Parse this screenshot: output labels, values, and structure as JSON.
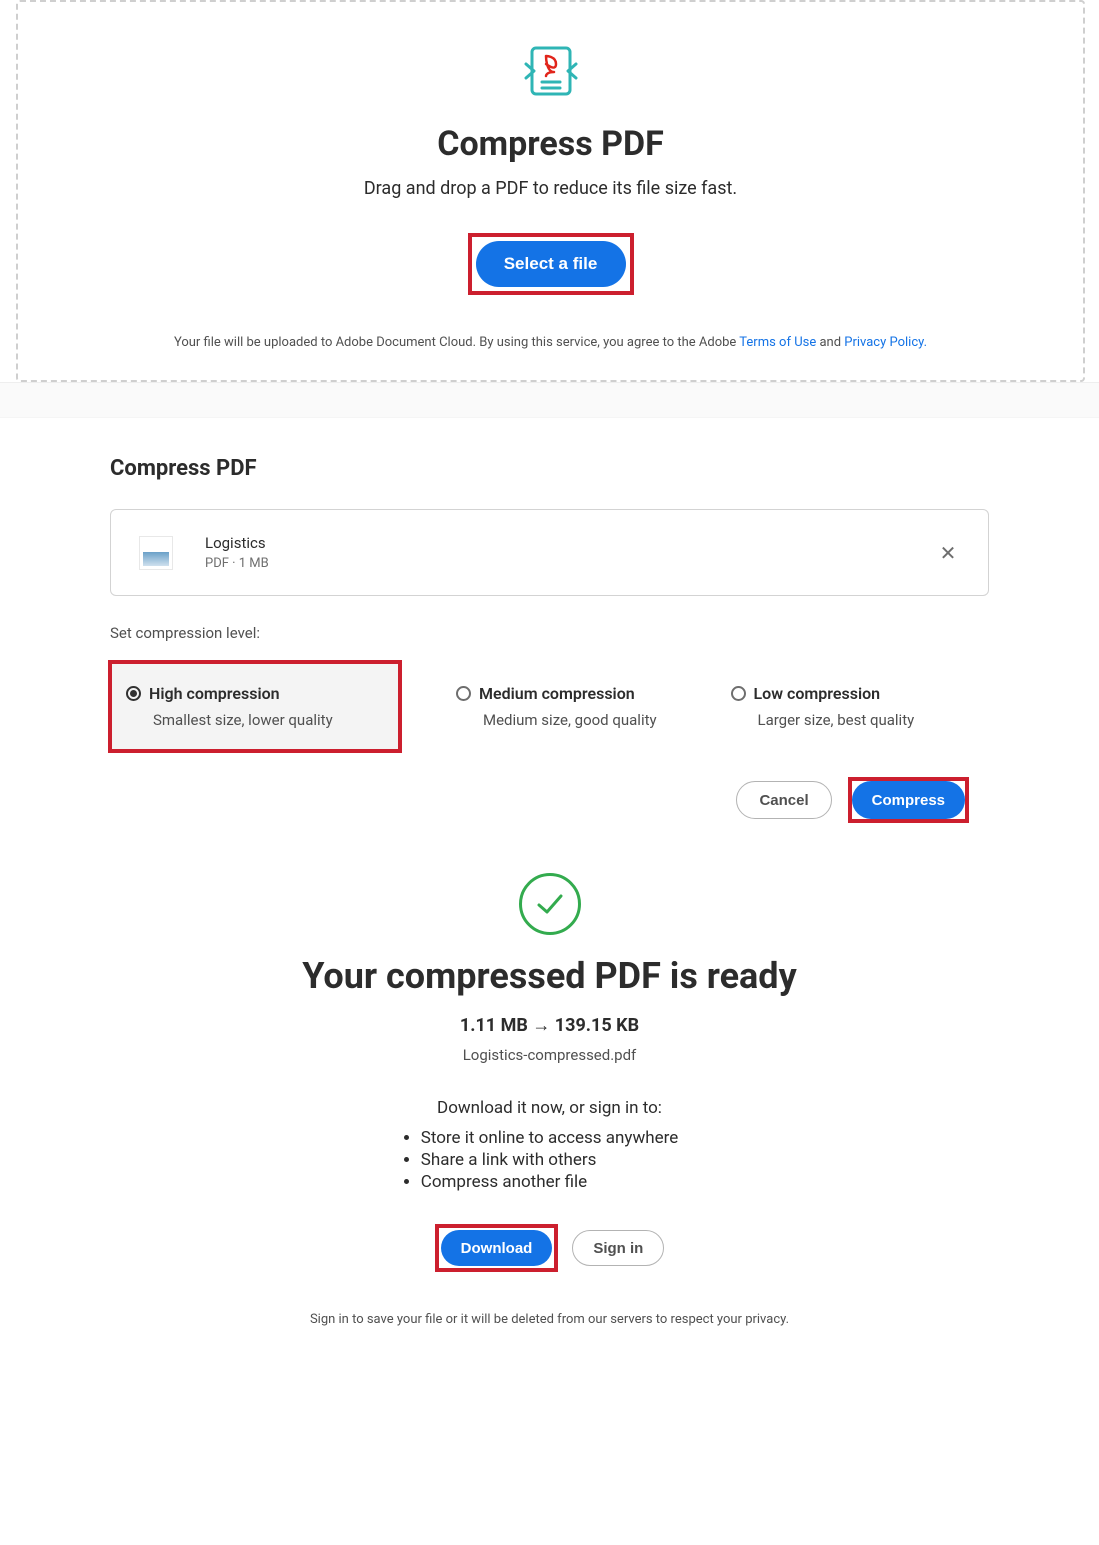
{
  "dropzone": {
    "title": "Compress PDF",
    "subtitle": "Drag and drop a PDF to reduce its file size fast.",
    "select_button": "Select a file",
    "legal_prefix": "Your file will be uploaded to Adobe Document Cloud.   By using this service, you agree to the Adobe ",
    "terms_link": "Terms of Use",
    "legal_mid": " and ",
    "privacy_link": "Privacy Policy.",
    "legal_suffix": ""
  },
  "settings": {
    "heading": "Compress PDF",
    "file": {
      "name": "Logistics",
      "meta": "PDF · 1 MB"
    },
    "level_label": "Set compression level:",
    "options": [
      {
        "title": "High compression",
        "sub": "Smallest size, lower quality",
        "selected": true
      },
      {
        "title": "Medium compression",
        "sub": "Medium size, good quality",
        "selected": false
      },
      {
        "title": "Low compression",
        "sub": "Larger size, best quality",
        "selected": false
      }
    ],
    "cancel": "Cancel",
    "compress": "Compress"
  },
  "ready": {
    "title": "Your compressed PDF is ready",
    "size_line": "1.11 MB → 139.15 KB",
    "filename": "Logistics-compressed.pdf",
    "lead": "Download it now, or sign in to:",
    "bullets": [
      "Store it online to access anywhere",
      "Share a link with others",
      "Compress another file"
    ],
    "download": "Download",
    "signin": "Sign in",
    "legal": "Sign in to save your file or it will be deleted from our servers to respect your privacy."
  }
}
